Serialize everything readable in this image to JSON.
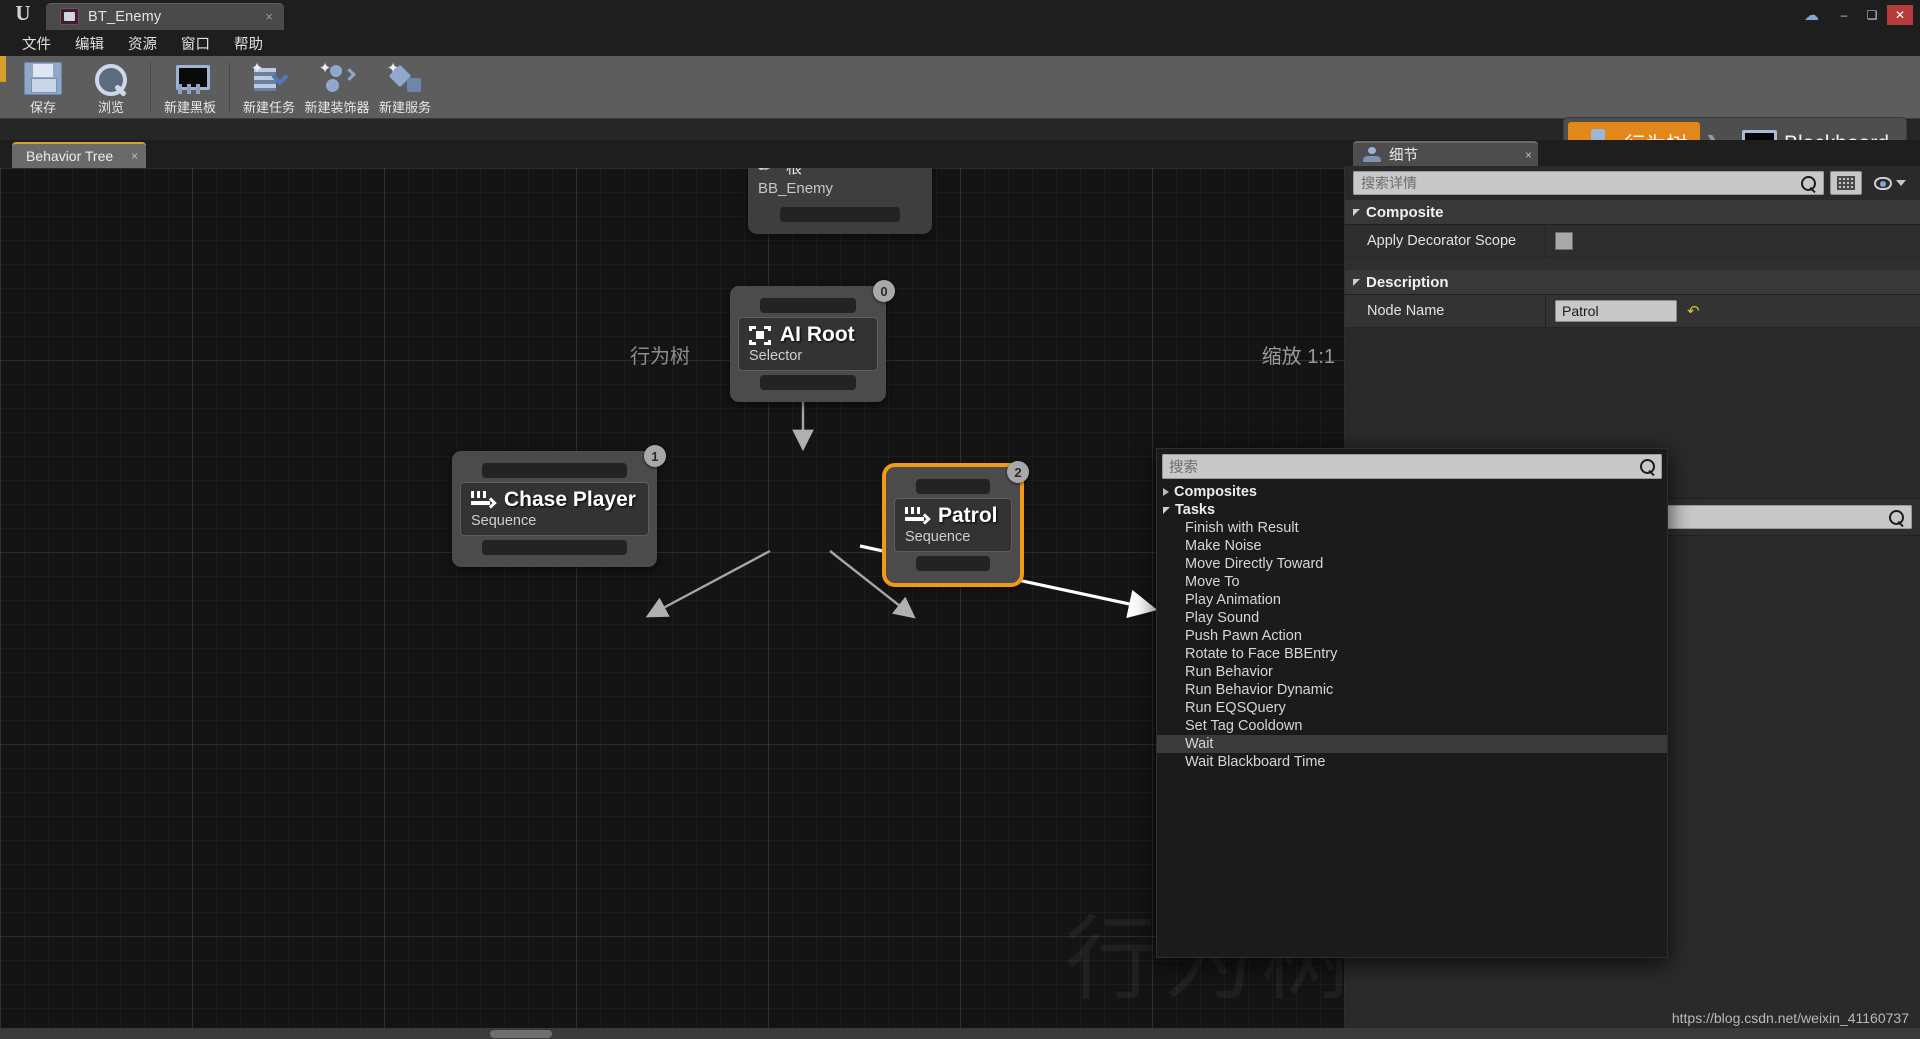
{
  "window": {
    "app_logo": "unreal-logo",
    "asset_tab_title": "BT_Enemy",
    "close_label": "×",
    "minimize_label": "–",
    "maximize_label": "❑",
    "win_close_label": "✕"
  },
  "menubar": {
    "items": [
      {
        "label": "文件"
      },
      {
        "label": "编辑"
      },
      {
        "label": "资源"
      },
      {
        "label": "窗口"
      },
      {
        "label": "帮助"
      }
    ]
  },
  "toolbar": {
    "buttons": [
      {
        "label": "保存",
        "icon": "save-icon"
      },
      {
        "label": "浏览",
        "icon": "browse-icon"
      },
      {
        "label": "新建黑板",
        "icon": "new-blackboard-icon"
      },
      {
        "label": "新建任务",
        "icon": "new-task-icon"
      },
      {
        "label": "新建装饰器",
        "icon": "new-decorator-icon"
      },
      {
        "label": "新建服务",
        "icon": "new-service-icon"
      }
    ]
  },
  "mode_switcher": {
    "separator": "❯",
    "modes": [
      {
        "label": "行为树",
        "icon": "behavior-tree-icon",
        "active": true
      },
      {
        "label": "Blackboard",
        "icon": "blackboard-icon",
        "active": false
      }
    ],
    "active_color": "#e2881a"
  },
  "graph": {
    "tab_label": "Behavior Tree",
    "tab_close": "×",
    "header_left": "行为树",
    "header_right": "缩放 1:1",
    "watermark": "行为树",
    "root_node": {
      "title": "根",
      "subtitle": "BB_Enemy"
    },
    "nodes": [
      {
        "title": "AI Root",
        "subtitle": "Selector",
        "badge": "0",
        "icon": "selector-icon",
        "selected": false
      },
      {
        "title": "Chase Player",
        "subtitle": "Sequence",
        "badge": "1",
        "icon": "sequence-icon",
        "selected": false
      },
      {
        "title": "Patrol",
        "subtitle": "Sequence",
        "badge": "2",
        "icon": "sequence-icon",
        "selected": true
      }
    ],
    "selection_color": "#f09a18"
  },
  "context_menu": {
    "search_placeholder": "搜索",
    "categories": [
      {
        "label": "Composites",
        "expanded": false
      },
      {
        "label": "Tasks",
        "expanded": true
      }
    ],
    "items": [
      {
        "label": "Finish with Result",
        "highlighted": false
      },
      {
        "label": "Make Noise",
        "highlighted": false
      },
      {
        "label": "Move Directly Toward",
        "highlighted": false
      },
      {
        "label": "Move To",
        "highlighted": false
      },
      {
        "label": "Play Animation",
        "highlighted": false
      },
      {
        "label": "Play Sound",
        "highlighted": false
      },
      {
        "label": "Push Pawn Action",
        "highlighted": false
      },
      {
        "label": "Rotate to Face BBEntry",
        "highlighted": false
      },
      {
        "label": "Run Behavior",
        "highlighted": false
      },
      {
        "label": "Run Behavior Dynamic",
        "highlighted": false
      },
      {
        "label": "Run EQSQuery",
        "highlighted": false
      },
      {
        "label": "Set Tag Cooldown",
        "highlighted": false
      },
      {
        "label": "Wait",
        "highlighted": true
      },
      {
        "label": "Wait Blackboard Time",
        "highlighted": false
      }
    ]
  },
  "details": {
    "tab_label": "细节",
    "tab_close": "×",
    "search_placeholder": "搜索详情",
    "lower_search_placeholder": "",
    "sections": [
      {
        "title": "Composite",
        "rows": [
          {
            "name": "Apply Decorator Scope",
            "type": "checkbox",
            "value": "",
            "checked": false
          }
        ]
      },
      {
        "title": "Description",
        "rows": [
          {
            "name": "Node Name",
            "type": "text",
            "value": "Patrol",
            "revert": "↶"
          }
        ]
      }
    ]
  },
  "footer": {
    "credit": "https://blog.csdn.net/weixin_41160737"
  }
}
